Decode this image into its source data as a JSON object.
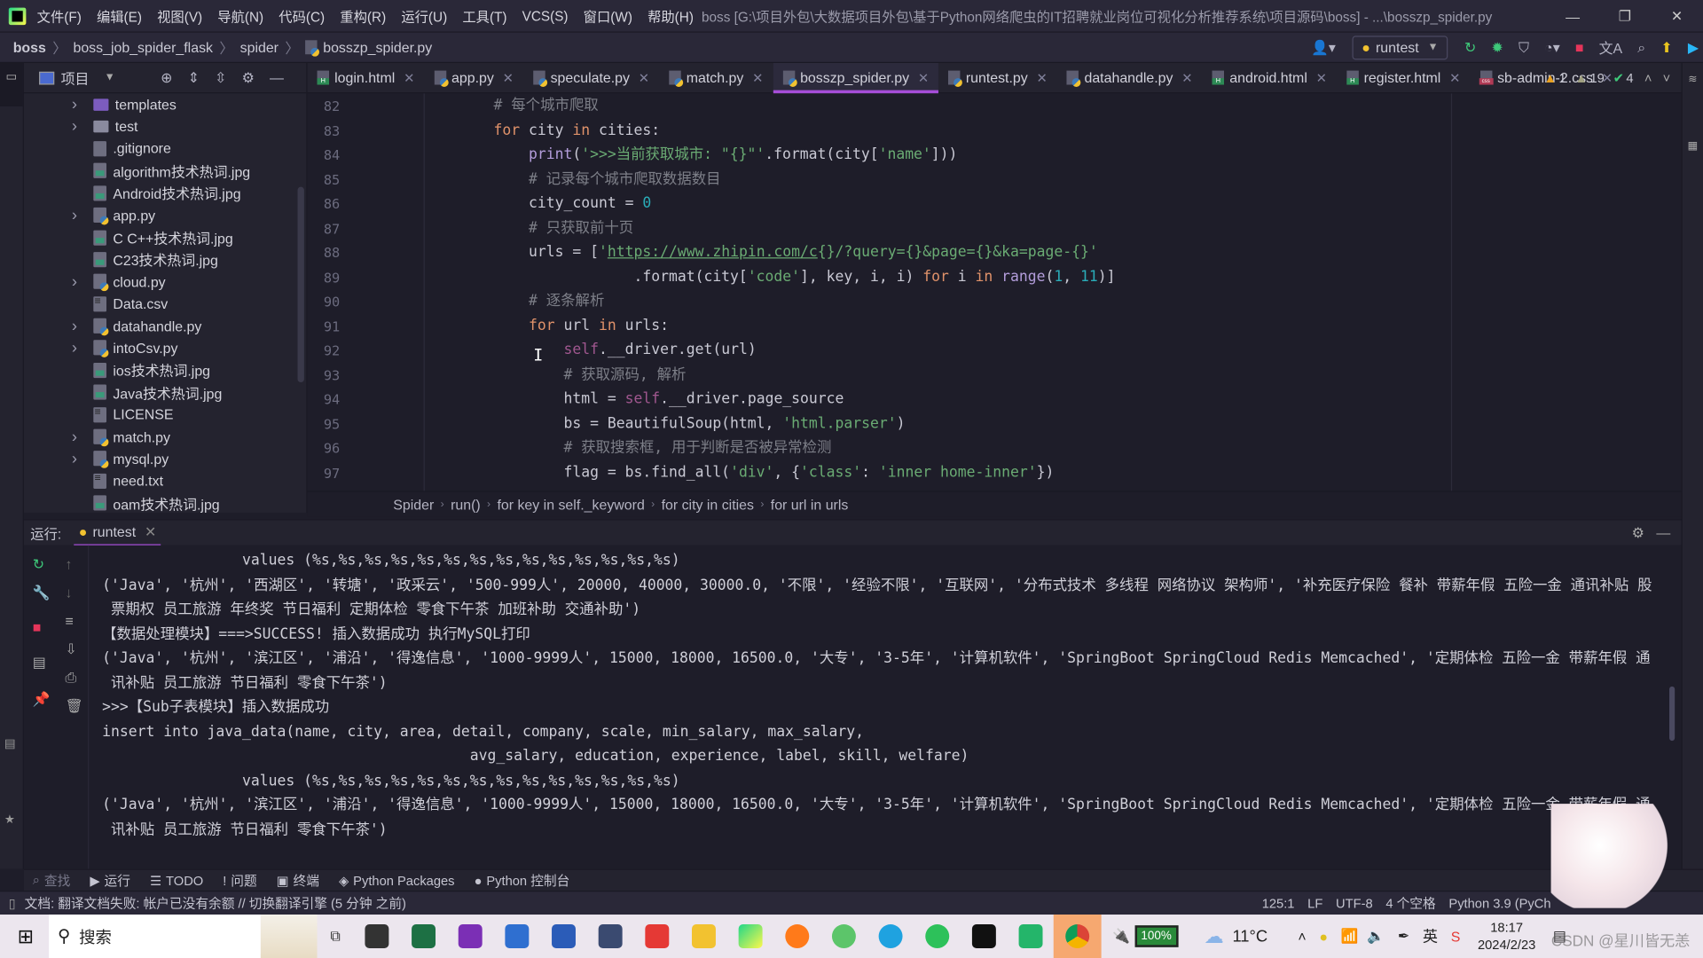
{
  "window": {
    "title": "boss [G:\\项目外包\\大数据项目外包\\基于Python网络爬虫的IT招聘就业岗位可视化分析推荐系统\\项目源码\\boss] - ...\\bosszp_spider.py",
    "menu": [
      "文件(F)",
      "编辑(E)",
      "视图(V)",
      "导航(N)",
      "代码(C)",
      "重构(R)",
      "运行(U)",
      "工具(T)",
      "VCS(S)",
      "窗口(W)",
      "帮助(H)"
    ]
  },
  "nav": {
    "breadcrumb": [
      "boss",
      "boss_job_spider_flask",
      "spider",
      "bosszp_spider.py"
    ],
    "run_config": "runtest"
  },
  "project": {
    "title": "项目",
    "items": [
      {
        "name": "templates",
        "type": "folder",
        "expand": true
      },
      {
        "name": "test",
        "type": "folder-plain",
        "expand": true
      },
      {
        "name": ".gitignore",
        "type": "file"
      },
      {
        "name": "algorithm技术热词.jpg",
        "type": "img"
      },
      {
        "name": "Android技术热词.jpg",
        "type": "img"
      },
      {
        "name": "app.py",
        "type": "py",
        "expand": true
      },
      {
        "name": "C C++技术热词.jpg",
        "type": "img"
      },
      {
        "name": "C23技术热词.jpg",
        "type": "img"
      },
      {
        "name": "cloud.py",
        "type": "py",
        "expand": true
      },
      {
        "name": "Data.csv",
        "type": "txt"
      },
      {
        "name": "datahandle.py",
        "type": "py",
        "expand": true
      },
      {
        "name": "intoCsv.py",
        "type": "py",
        "expand": true
      },
      {
        "name": "ios技术热词.jpg",
        "type": "img"
      },
      {
        "name": "Java技术热词.jpg",
        "type": "img"
      },
      {
        "name": "LICENSE",
        "type": "txt"
      },
      {
        "name": "match.py",
        "type": "py",
        "expand": true
      },
      {
        "name": "mysql.py",
        "type": "py",
        "expand": true
      },
      {
        "name": "need.txt",
        "type": "txt"
      },
      {
        "name": "oam技术热词.jpg",
        "type": "img"
      }
    ]
  },
  "tabs": [
    {
      "label": "login.html",
      "type": "html"
    },
    {
      "label": "app.py",
      "type": "py"
    },
    {
      "label": "speculate.py",
      "type": "py"
    },
    {
      "label": "match.py",
      "type": "py"
    },
    {
      "label": "bosszp_spider.py",
      "type": "py",
      "active": true
    },
    {
      "label": "runtest.py",
      "type": "py"
    },
    {
      "label": "datahandle.py",
      "type": "py"
    },
    {
      "label": "android.html",
      "type": "html"
    },
    {
      "label": "register.html",
      "type": "html"
    },
    {
      "label": "sb-admin-2.css",
      "type": "css"
    }
  ],
  "inspections": {
    "warnings": "1",
    "weak_warnings": "19",
    "ok": "4"
  },
  "code": [
    {
      "n": "82",
      "t": [
        [
          "        ",
          ""
        ],
        [
          "# 每个城市爬取",
          "c"
        ]
      ]
    },
    {
      "n": "83",
      "t": [
        [
          "        ",
          ""
        ],
        [
          "for",
          "k"
        ],
        [
          " city ",
          ""
        ],
        [
          "in",
          "k"
        ],
        [
          " cities:",
          ""
        ]
      ]
    },
    {
      "n": "84",
      "t": [
        [
          "            ",
          ""
        ],
        [
          "print",
          "f"
        ],
        [
          "(",
          ""
        ],
        [
          "'>>>当前获取城市: \"{}\"'",
          "s"
        ],
        [
          ".format(city[",
          ""
        ],
        [
          "'name'",
          "s"
        ],
        [
          "]))",
          ""
        ]
      ]
    },
    {
      "n": "85",
      "t": [
        [
          "            ",
          ""
        ],
        [
          "# 记录每个城市爬取数据数目",
          "c"
        ]
      ]
    },
    {
      "n": "86",
      "t": [
        [
          "            city_count = ",
          ""
        ],
        [
          "0",
          "n"
        ]
      ]
    },
    {
      "n": "87",
      "t": [
        [
          "            ",
          ""
        ],
        [
          "# 只获取前十页",
          "c"
        ]
      ]
    },
    {
      "n": "88",
      "t": [
        [
          "            urls = [",
          ""
        ],
        [
          "'",
          "s"
        ],
        [
          "https://www.zhipin.com/c",
          "u"
        ],
        [
          "{}/?query={}&page={}&ka=page-{}'",
          "s"
        ]
      ]
    },
    {
      "n": "89",
      "t": [
        [
          "                        .format(city[",
          ""
        ],
        [
          "'code'",
          "s"
        ],
        [
          "], key, i, i) ",
          ""
        ],
        [
          "for",
          "k"
        ],
        [
          " i ",
          ""
        ],
        [
          "in",
          "k"
        ],
        [
          " ",
          ""
        ],
        [
          "range",
          "f"
        ],
        [
          "(",
          ""
        ],
        [
          "1",
          "n"
        ],
        [
          ", ",
          ""
        ],
        [
          "11",
          "n"
        ],
        [
          ")]",
          ""
        ]
      ]
    },
    {
      "n": "90",
      "t": [
        [
          "            ",
          ""
        ],
        [
          "# 逐条解析",
          "c"
        ]
      ]
    },
    {
      "n": "91",
      "t": [
        [
          "            ",
          ""
        ],
        [
          "for",
          "k"
        ],
        [
          " url ",
          ""
        ],
        [
          "in",
          "k"
        ],
        [
          " urls:",
          ""
        ]
      ]
    },
    {
      "n": "92",
      "t": [
        [
          "                ",
          ""
        ],
        [
          "self",
          "self"
        ],
        [
          ".__driver.get(url)",
          ""
        ]
      ]
    },
    {
      "n": "93",
      "t": [
        [
          "                ",
          ""
        ],
        [
          "# 获取源码, 解析",
          "c"
        ]
      ]
    },
    {
      "n": "94",
      "t": [
        [
          "                html = ",
          ""
        ],
        [
          "self",
          "self"
        ],
        [
          ".__driver.page_source",
          ""
        ]
      ]
    },
    {
      "n": "95",
      "t": [
        [
          "                bs = BeautifulSoup(html, ",
          ""
        ],
        [
          "'html.parser'",
          "s"
        ],
        [
          ")",
          ""
        ]
      ]
    },
    {
      "n": "96",
      "t": [
        [
          "                ",
          ""
        ],
        [
          "# 获取搜索框, 用于判断是否被异常检测",
          "c"
        ]
      ]
    },
    {
      "n": "97",
      "t": [
        [
          "                flag = bs.find_all(",
          ""
        ],
        [
          "'div'",
          "s"
        ],
        [
          ", {",
          ""
        ],
        [
          "'class'",
          "s"
        ],
        [
          ": ",
          ""
        ],
        [
          "'inner home-inner'",
          "s"
        ],
        [
          "})",
          ""
        ]
      ]
    }
  ],
  "code_breadcrumb": [
    "Spider",
    "run()",
    "for key in self._keyword",
    "for city in cities",
    "for url in urls"
  ],
  "run": {
    "label": "运行:",
    "tab": "runtest",
    "output": [
      "                values (%s,%s,%s,%s,%s,%s,%s,%s,%s,%s,%s,%s,%s,%s)",
      "('Java', '杭州', '西湖区', '转塘', '政采云', '500-999人', 20000, 40000, 30000.0, '不限', '经验不限', '互联网', '分布式技术 多线程 网络协议 架构师', '补充医疗保险 餐补 带薪年假 五险一金 通讯补贴 股",
      " 票期权 员工旅游 年终奖 节日福利 定期体检 零食下午茶 加班补助 交通补助')",
      "【数据处理模块】===>SUCCESS! 插入数据成功 执行MySQL打印",
      "('Java', '杭州', '滨江区', '浦沿', '得逸信息', '1000-9999人', 15000, 18000, 16500.0, '大专', '3-5年', '计算机软件', 'SpringBoot SpringCloud Redis Memcached', '定期体检 五险一金 带薪年假 通",
      " 讯补贴 员工旅游 节日福利 零食下午茶')",
      ">>>【Sub子表模块】插入数据成功",
      "insert into java_data(name, city, area, detail, company, scale, min_salary, max_salary,",
      "                                          avg_salary, education, experience, label, skill, welfare)",
      "                values (%s,%s,%s,%s,%s,%s,%s,%s,%s,%s,%s,%s,%s,%s)",
      "('Java', '杭州', '滨江区', '浦沿', '得逸信息', '1000-9999人', 15000, 18000, 16500.0, '大专', '3-5年', '计算机软件', 'SpringBoot SpringCloud Redis Memcached', '定期体检 五险一金 带薪年假 通",
      " 讯补贴 员工旅游 节日福利 零食下午茶')"
    ]
  },
  "tool_tabs": [
    "查找",
    "运行",
    "TODO",
    "问题",
    "终端",
    "Python Packages",
    "Python 控制台"
  ],
  "status": {
    "message": "文档: 翻译文档失败: 帐户已没有余额 // 切换翻译引擎 (5 分钟 之前)",
    "position": "125:1",
    "line_sep": "LF",
    "encoding": "UTF-8",
    "indent": "4 个空格",
    "interpreter": "Python 3.9 (PyCh"
  },
  "taskbar": {
    "search": "搜索",
    "battery": "100%",
    "weather": "11°C",
    "ime": "英",
    "time": "18:17",
    "date": "2024/2/23",
    "watermark": "CSDN @星川皆无恙"
  },
  "colors": {
    "accent": "#a64ed8",
    "editor_bg": "#1e1d29",
    "panel_bg": "#24232f"
  }
}
